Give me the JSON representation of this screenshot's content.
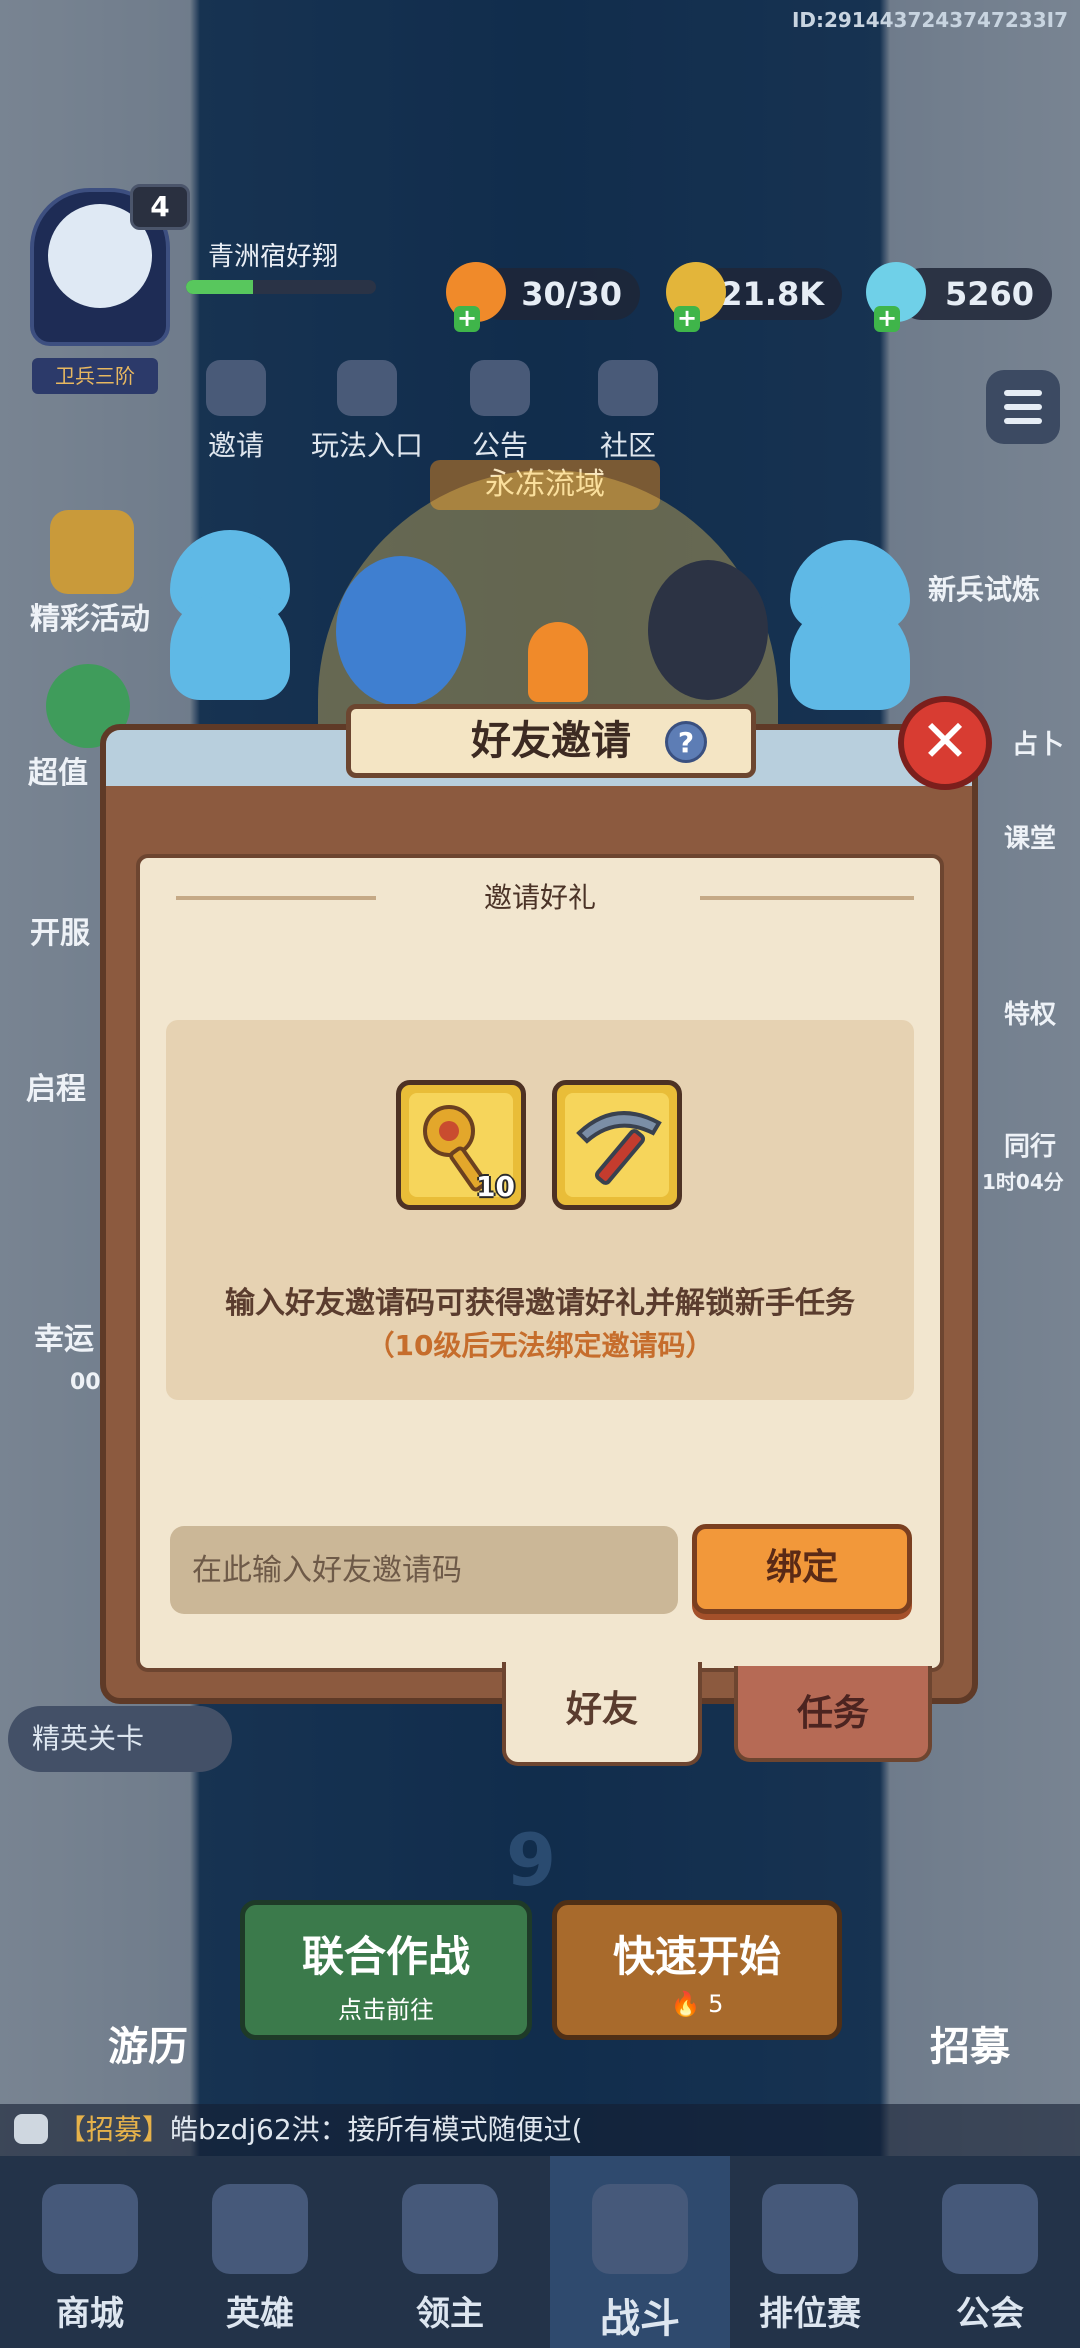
{
  "header": {
    "user_id": "ID:2914437243747233I7",
    "player_name": "青洲宿好翔",
    "level": "4",
    "rank": "卫兵三阶",
    "xp_progress": 0.35,
    "resources": {
      "stamina": "30/30",
      "gold": "21.8K",
      "gems": "5260"
    }
  },
  "top_menu": {
    "invite": "邀请",
    "gameplay": "玩法入口",
    "notice": "公告",
    "community": "社区"
  },
  "zone_banner": "永冻流域",
  "left_side": {
    "events": "精彩活动",
    "super": "超值",
    "server_open": "开服",
    "journey": "启程",
    "lucky": "幸运",
    "lucky_timer": "00"
  },
  "right_side": {
    "recruit_trial": "新兵试炼",
    "divination": "占卜",
    "classroom": "课堂",
    "privilege": "特权",
    "companion": "同行",
    "companion_timer": "1时04分"
  },
  "modal": {
    "title": "好友邀请",
    "help": "?",
    "close": "✕",
    "section_title": "邀请好礼",
    "rewards": [
      {
        "icon": "golden-key-icon",
        "count": "10"
      },
      {
        "icon": "pickaxe-icon",
        "count": ""
      }
    ],
    "description": "输入好友邀请码可获得邀请好礼并解锁新手任务",
    "warning": "（10级后无法绑定邀请码）",
    "input_placeholder": "在此输入好友邀请码",
    "bind_button": "绑定",
    "tabs": {
      "friend": "好友",
      "task": "任务"
    }
  },
  "background": {
    "elite_stage": "精英关卡",
    "stage_number": "9",
    "coop_battle": "联合作战",
    "coop_sub": "点击前往",
    "quick_start": "快速开始",
    "quick_start_cost": "5",
    "travel": "游历",
    "recruit": "招募"
  },
  "ticker": {
    "tag": "【招募】",
    "message": "皓bzdj62洪：接所有模式随便过("
  },
  "nav": {
    "shop": "商城",
    "heroes": "英雄",
    "lord": "领主",
    "battle": "战斗",
    "ranked": "排位赛",
    "guild": "公会"
  },
  "colors": {
    "modal_frame": "#8c5a3f",
    "modal_body": "#f2e6cf",
    "bind_button": "#f2983a",
    "warning_text": "#c66d2c",
    "close_button": "#d83c32"
  }
}
